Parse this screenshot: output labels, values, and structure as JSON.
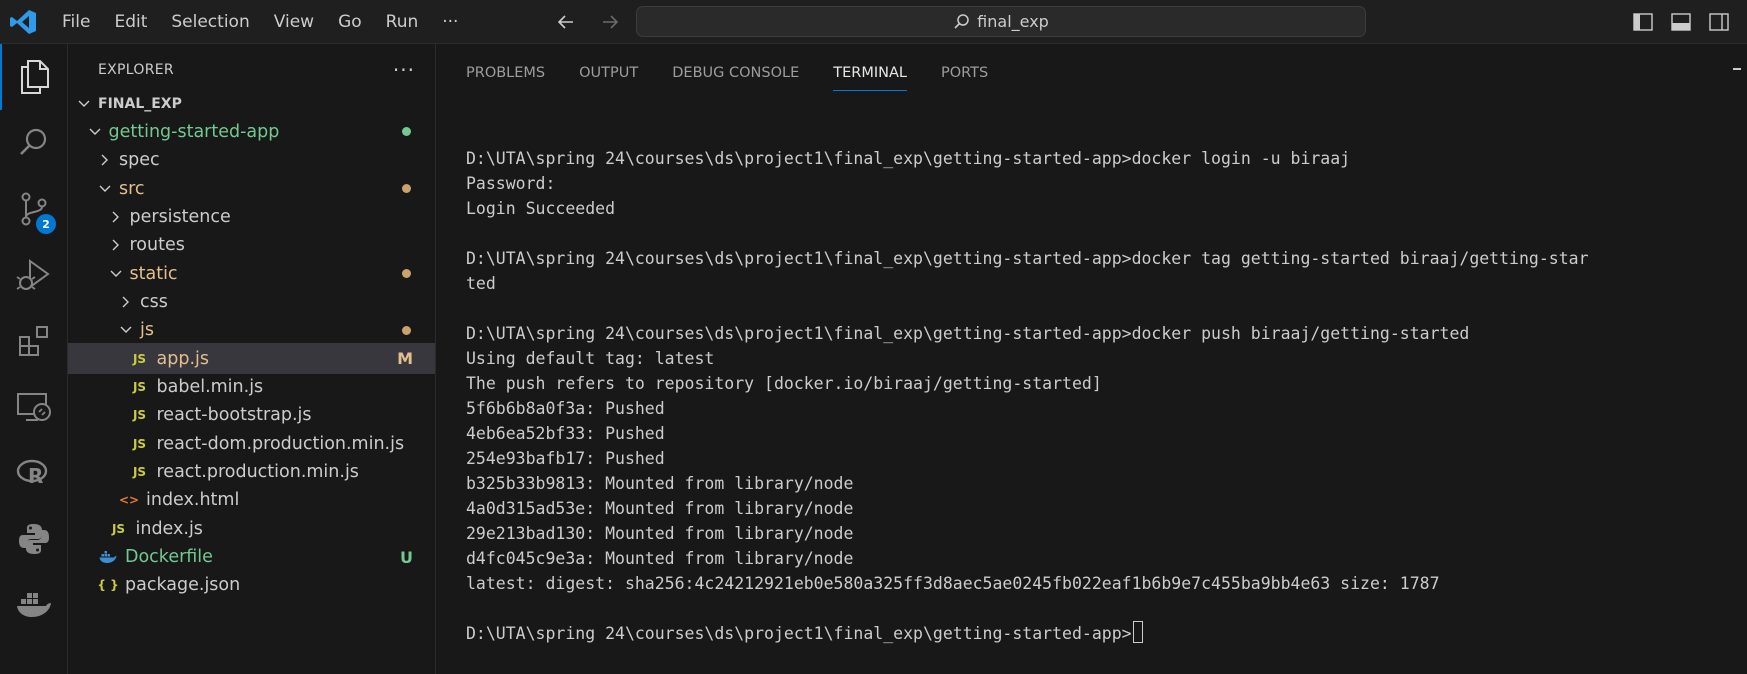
{
  "titlebar": {
    "menus": [
      "File",
      "Edit",
      "Selection",
      "View",
      "Go",
      "Run",
      "···"
    ],
    "search_text": "final_exp"
  },
  "activitybar": {
    "items": [
      "explorer-icon",
      "search-icon",
      "source-control-icon",
      "run-debug-icon",
      "extensions-icon",
      "remote-explorer-icon",
      "r-icon",
      "python-icon",
      "docker-icon"
    ],
    "source_control_badge": "2"
  },
  "sidebar": {
    "title": "EXPLORER",
    "more": "···",
    "tree": [
      {
        "label": "FINAL_EXP",
        "level": 0,
        "chevron": "down",
        "bold": true
      },
      {
        "label": "getting-started-app",
        "level": 1,
        "chevron": "down",
        "color": "#73c991",
        "dot": "#73c991"
      },
      {
        "label": "spec",
        "level": 2,
        "chevron": "right"
      },
      {
        "label": "src",
        "level": 2,
        "chevron": "down",
        "color": "#e2c08d",
        "dot": "#c9a36b"
      },
      {
        "label": "persistence",
        "level": 3,
        "chevron": "right"
      },
      {
        "label": "routes",
        "level": 3,
        "chevron": "right"
      },
      {
        "label": "static",
        "level": 3,
        "chevron": "down",
        "color": "#e2c08d",
        "dot": "#c9a36b"
      },
      {
        "label": "css",
        "level": 4,
        "chevron": "right"
      },
      {
        "label": "js",
        "level": 4,
        "chevron": "down",
        "color": "#e2c08d",
        "dot": "#c9a36b"
      },
      {
        "label": "app.js",
        "level": 5,
        "icon": "JS",
        "color": "#e2c08d",
        "status": "M",
        "selected": true
      },
      {
        "label": "babel.min.js",
        "level": 5,
        "icon": "JS"
      },
      {
        "label": "react-bootstrap.js",
        "level": 5,
        "icon": "JS"
      },
      {
        "label": "react-dom.production.min.js",
        "level": 5,
        "icon": "JS"
      },
      {
        "label": "react.production.min.js",
        "level": 5,
        "icon": "JS"
      },
      {
        "label": "index.html",
        "level": 4,
        "icon": "<>"
      },
      {
        "label": "index.js",
        "level": 3,
        "icon": "JS"
      },
      {
        "label": "Dockerfile",
        "level": 2,
        "icon": "docker",
        "color": "#73c991",
        "status": "U"
      },
      {
        "label": "package.json",
        "level": 2,
        "icon": "{}"
      }
    ]
  },
  "panel": {
    "tabs": [
      "PROBLEMS",
      "OUTPUT",
      "DEBUG CONSOLE",
      "TERMINAL",
      "PORTS"
    ],
    "active_tab": "TERMINAL",
    "terminal_lines": [
      "D:\\UTA\\spring 24\\courses\\ds\\project1\\final_exp\\getting-started-app>docker login -u biraaj",
      "Password:",
      "Login Succeeded",
      "",
      "D:\\UTA\\spring 24\\courses\\ds\\project1\\final_exp\\getting-started-app>docker tag getting-started biraaj/getting-star",
      "ted",
      "",
      "D:\\UTA\\spring 24\\courses\\ds\\project1\\final_exp\\getting-started-app>docker push biraaj/getting-started",
      "Using default tag: latest",
      "The push refers to repository [docker.io/biraaj/getting-started]",
      "5f6b6b8a0f3a: Pushed",
      "4eb6ea52bf33: Pushed",
      "254e93bafb17: Pushed",
      "b325b33b9813: Mounted from library/node",
      "4a0d315ad53e: Mounted from library/node",
      "29e213bad130: Mounted from library/node",
      "d4fc045c9e3a: Mounted from library/node",
      "latest: digest: sha256:4c24212921eb0e580a325ff3d8aec5ae0245fb022eaf1b6b9e7c455ba9bb4e63 size: 1787",
      "",
      "D:\\UTA\\spring 24\\courses\\ds\\project1\\final_exp\\getting-started-app>"
    ]
  }
}
